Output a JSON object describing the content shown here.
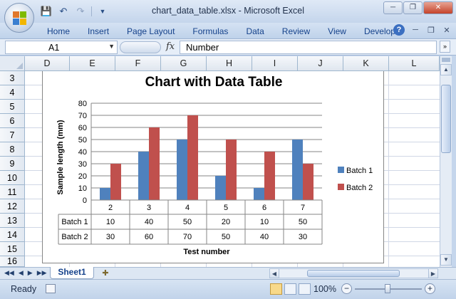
{
  "window": {
    "title": "chart_data_table.xlsx - Microsoft Excel",
    "controls": [
      "minimize",
      "restore",
      "close"
    ]
  },
  "quick_access": {
    "icons": [
      "save-icon",
      "undo-icon",
      "redo-icon",
      "customize-icon"
    ]
  },
  "ribbon": {
    "tabs": [
      "Home",
      "Insert",
      "Page Layout",
      "Formulas",
      "Data",
      "Review",
      "View",
      "Developer"
    ]
  },
  "formula_bar": {
    "name_box": "A1",
    "fx_label": "fx",
    "value": "Number"
  },
  "grid": {
    "columns": [
      "D",
      "E",
      "F",
      "G",
      "H",
      "I",
      "J",
      "K",
      "L"
    ],
    "rows": [
      "3",
      "4",
      "5",
      "6",
      "7",
      "8",
      "9",
      "10",
      "11",
      "12",
      "13",
      "14",
      "15",
      "16"
    ]
  },
  "chart_data": {
    "type": "bar",
    "title": "Chart with Data Table",
    "xlabel": "Test number",
    "ylabel": "Sample length (mm)",
    "categories": [
      "2",
      "3",
      "4",
      "5",
      "6",
      "7"
    ],
    "series": [
      {
        "name": "Batch 1",
        "values": [
          10,
          40,
          50,
          20,
          10,
          50
        ],
        "color": "#4f81bd"
      },
      {
        "name": "Batch 2",
        "values": [
          30,
          60,
          70,
          50,
          40,
          30
        ],
        "color": "#c0504d"
      }
    ],
    "ylim": [
      0,
      80
    ],
    "yticks": [
      "0",
      "10",
      "20",
      "30",
      "40",
      "50",
      "60",
      "70",
      "80"
    ],
    "grid": true,
    "legend": "right",
    "data_table": true
  },
  "sheets": {
    "tabs": [
      "Sheet1"
    ],
    "active": "Sheet1"
  },
  "status": {
    "text": "Ready",
    "zoom": "100%",
    "zoom_level": 1.0
  }
}
